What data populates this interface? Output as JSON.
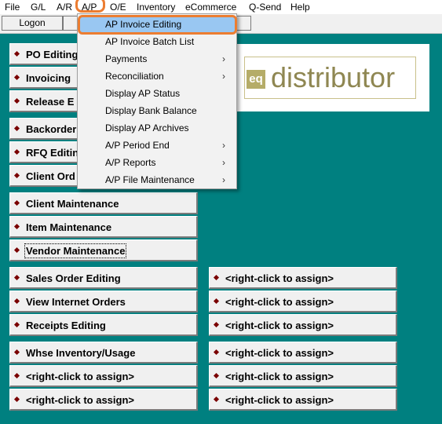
{
  "menubar": {
    "items": [
      "File",
      "G/L",
      "A/R",
      "A/P",
      "O/E",
      "Inventory",
      "eCommerce",
      "Q-Send",
      "Help"
    ]
  },
  "toolbar": {
    "logon_label": "Logon"
  },
  "logo": {
    "mark": "eq",
    "text": "distributor"
  },
  "ap_menu": {
    "items": [
      {
        "label": "AP Invoice Editing",
        "submenu": false,
        "selected": true
      },
      {
        "label": "AP Invoice Batch List",
        "submenu": false
      },
      {
        "label": "Payments",
        "submenu": true
      },
      {
        "label": "Reconciliation",
        "submenu": true
      },
      {
        "label": "Display AP Status",
        "submenu": false
      },
      {
        "label": "Display Bank Balance",
        "submenu": false
      },
      {
        "label": "Display AP Archives",
        "submenu": false
      },
      {
        "label": "A/P Period End",
        "submenu": true
      },
      {
        "label": "A/P Reports",
        "submenu": true
      },
      {
        "label": "A/P File Maintenance",
        "submenu": true
      }
    ],
    "submenu_arrow": "›"
  },
  "left_buttons": [
    "PO Editing",
    "Invoicing",
    "Release E",
    "Backorder",
    "RFQ Editin",
    "Client Ord",
    "Client Maintenance",
    "Item Maintenance",
    "Vendor Maintenance",
    "Sales Order Editing",
    "View Internet Orders",
    "Receipts Editing",
    "Whse Inventory/Usage",
    "<right-click to assign>",
    "<right-click to assign>"
  ],
  "right_buttons": [
    "<right-click to assign>",
    "<right-click to assign>",
    "<right-click to assign>",
    "<right-click to assign>",
    "<right-click to assign>",
    "<right-click to assign>"
  ]
}
